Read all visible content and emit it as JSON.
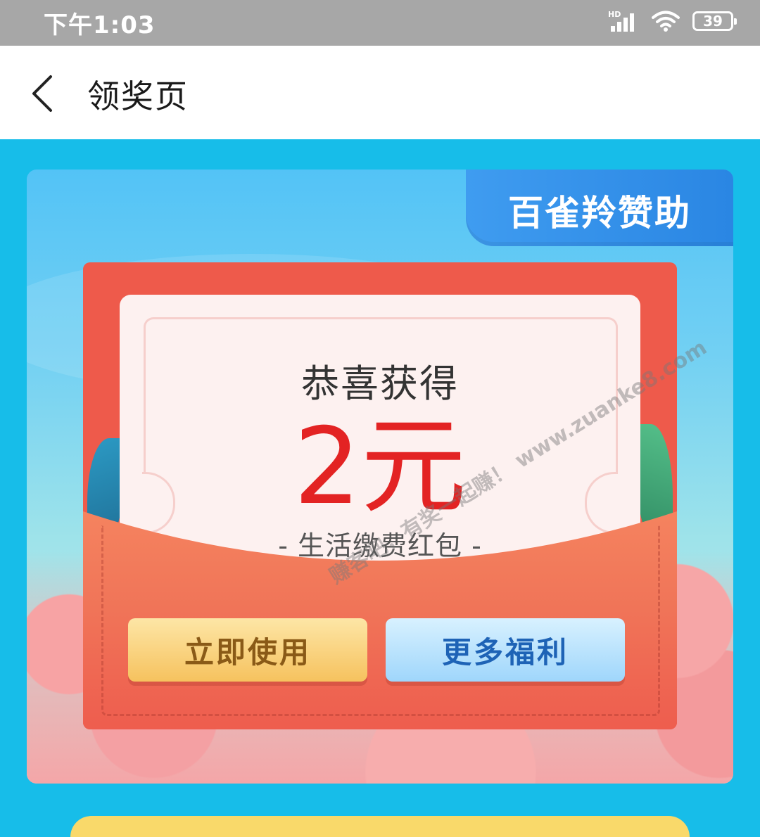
{
  "status_bar": {
    "time": "下午1:03",
    "network": "HD",
    "battery": "39"
  },
  "header": {
    "title": "领奖页"
  },
  "card": {
    "sponsor": "百雀羚赞助",
    "congrats": "恭喜获得",
    "amount": "2元",
    "subtitle": "- 生活缴费红包 -",
    "use_button": "立即使用",
    "more_button": "更多福利",
    "watermark": "赚客吧，有奖一起赚！ www.zuanke8.com"
  },
  "colors": {
    "page_bg": "#17bde9",
    "envelope": "#ee5a4b",
    "amount": "#e32323",
    "sponsor_badge": "#2a86e3"
  }
}
